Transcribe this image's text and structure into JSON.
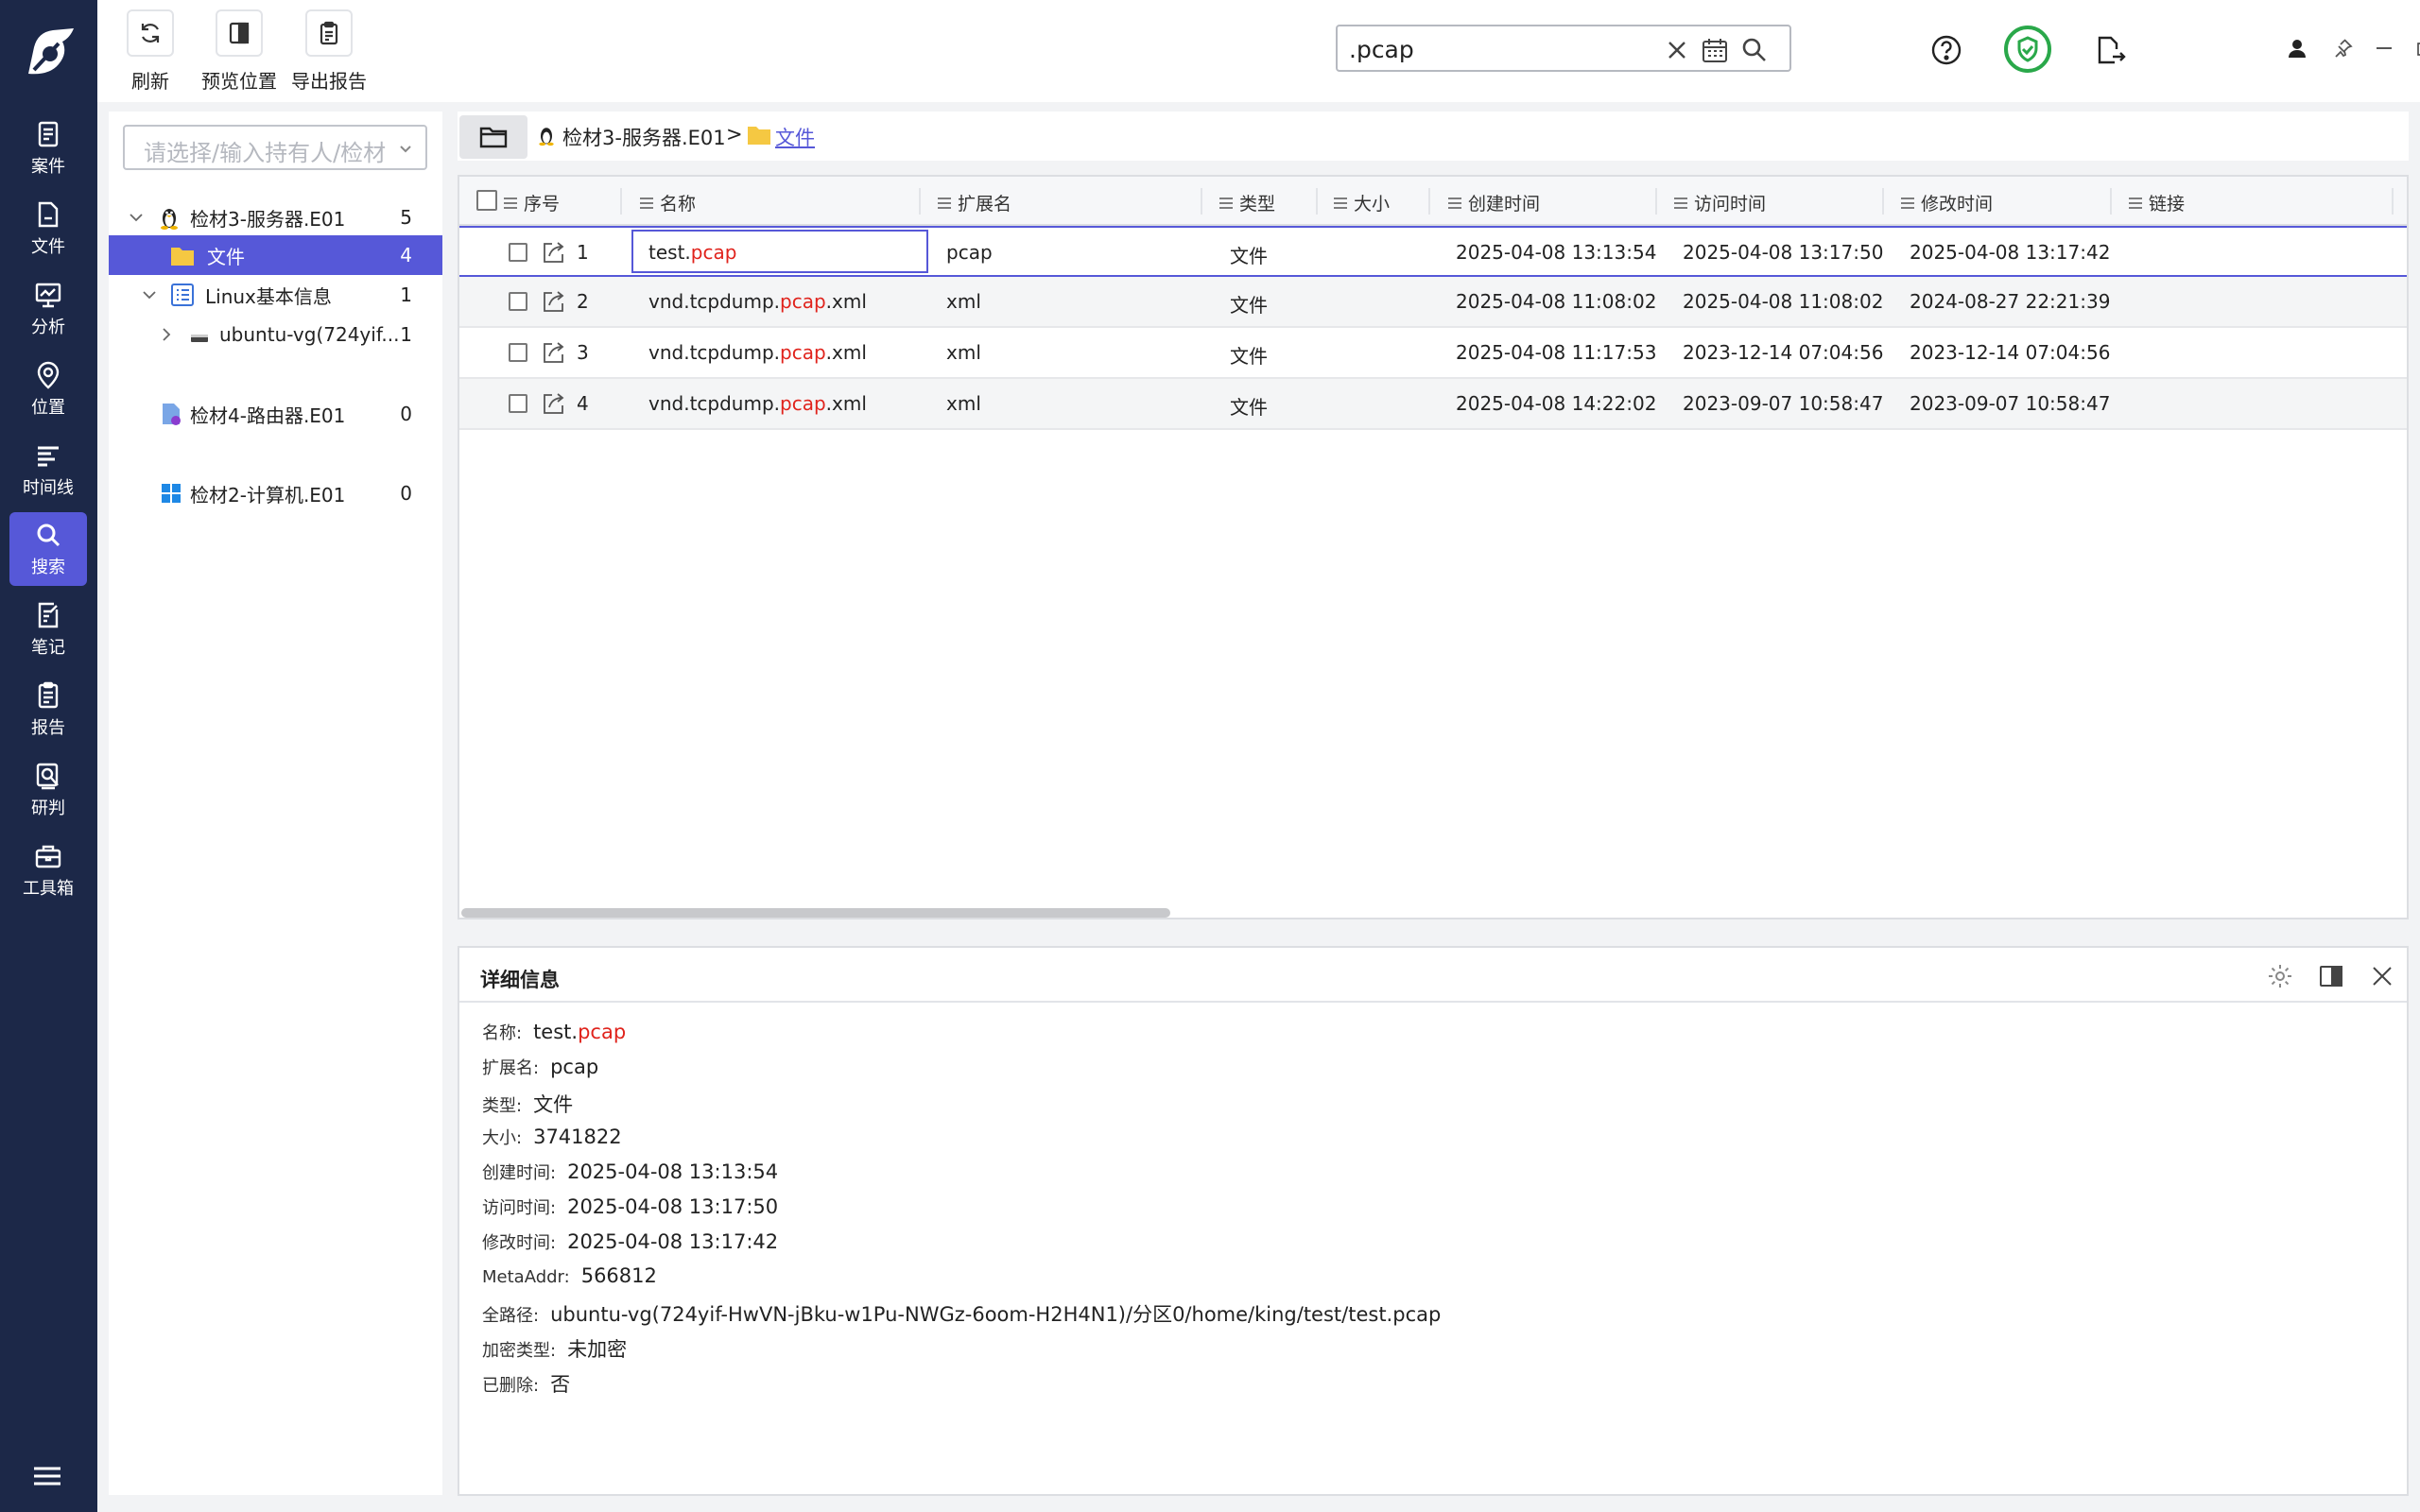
{
  "nav": {
    "items": [
      {
        "label": "案件",
        "icon": "case-icon"
      },
      {
        "label": "文件",
        "icon": "file-icon"
      },
      {
        "label": "分析",
        "icon": "analysis-icon"
      },
      {
        "label": "位置",
        "icon": "location-icon"
      },
      {
        "label": "时间线",
        "icon": "timeline-icon"
      },
      {
        "label": "搜索",
        "icon": "search-icon",
        "active": true
      },
      {
        "label": "笔记",
        "icon": "note-icon"
      },
      {
        "label": "报告",
        "icon": "report-icon"
      },
      {
        "label": "研判",
        "icon": "judge-icon"
      },
      {
        "label": "工具箱",
        "icon": "toolbox-icon"
      }
    ]
  },
  "toolbar": {
    "refresh_label": "刷新",
    "preview_label": "预览位置",
    "export_label": "导出报告"
  },
  "search": {
    "value": ".pcap"
  },
  "tree": {
    "owner_placeholder": "请选择/输入持有人/检材",
    "nodes": [
      {
        "label": "检材3-服务器.E01",
        "count": "5"
      },
      {
        "label": "文件",
        "count": "4"
      },
      {
        "label": "Linux基本信息",
        "count": "1"
      },
      {
        "label": "ubuntu-vg(724yif...",
        "count": "1"
      },
      {
        "label": "检材4-路由器.E01",
        "count": "0"
      },
      {
        "label": "检材2-计算机.E01",
        "count": "0"
      }
    ]
  },
  "breadcrumb": {
    "root": "检材3-服务器.E01",
    "separator": ">",
    "current": "文件"
  },
  "table": {
    "columns": [
      "序号",
      "名称",
      "扩展名",
      "类型",
      "大小",
      "创建时间",
      "访问时间",
      "修改时间",
      "链接"
    ],
    "rows": [
      {
        "index": "1",
        "name_pre": "test.",
        "name_hl": "pcap",
        "name_post": "",
        "ext": "pcap",
        "type": "文件",
        "size": "",
        "created": "2025-04-08 13:13:54",
        "accessed": "2025-04-08 13:17:50",
        "modified": "2025-04-08 13:17:42",
        "link": ""
      },
      {
        "index": "2",
        "name_pre": "vnd.tcpdump.",
        "name_hl": "pcap",
        "name_post": ".xml",
        "ext": "xml",
        "type": "文件",
        "size": "",
        "created": "2025-04-08 11:08:02",
        "accessed": "2025-04-08 11:08:02",
        "modified": "2024-08-27 22:21:39",
        "link": ""
      },
      {
        "index": "3",
        "name_pre": "vnd.tcpdump.",
        "name_hl": "pcap",
        "name_post": ".xml",
        "ext": "xml",
        "type": "文件",
        "size": "",
        "created": "2025-04-08 11:17:53",
        "accessed": "2023-12-14 07:04:56",
        "modified": "2023-12-14 07:04:56",
        "link": ""
      },
      {
        "index": "4",
        "name_pre": "vnd.tcpdump.",
        "name_hl": "pcap",
        "name_post": ".xml",
        "ext": "xml",
        "type": "文件",
        "size": "",
        "created": "2025-04-08 14:22:02",
        "accessed": "2023-09-07 10:58:47",
        "modified": "2023-09-07 10:58:47",
        "link": ""
      }
    ]
  },
  "detail": {
    "title": "详细信息",
    "name_label": "名称:",
    "name_pre": "test.",
    "name_hl": "pcap",
    "fields": [
      {
        "label": "扩展名:",
        "value": "pcap"
      },
      {
        "label": "类型:",
        "value": "文件"
      },
      {
        "label": "大小:",
        "value": "3741822"
      },
      {
        "label": "创建时间:",
        "value": "2025-04-08 13:13:54"
      },
      {
        "label": "访问时间:",
        "value": "2025-04-08 13:17:50"
      },
      {
        "label": "修改时间:",
        "value": "2025-04-08 13:17:42"
      },
      {
        "label": "MetaAddr:",
        "value": "566812"
      },
      {
        "label": "全路径:",
        "value": "ubuntu-vg(724yif-HwVN-jBku-w1Pu-NWGz-6oom-H2H4N1)/分区0/home/king/test/test.pcap"
      },
      {
        "label": "加密类型:",
        "value": "未加密"
      },
      {
        "label": "已删除:",
        "value": "否"
      }
    ]
  },
  "colors": {
    "nav_bg": "#1c2848",
    "accent": "#5658d8",
    "highlight": "#e0231c",
    "shield_green": "#2aa84a"
  }
}
